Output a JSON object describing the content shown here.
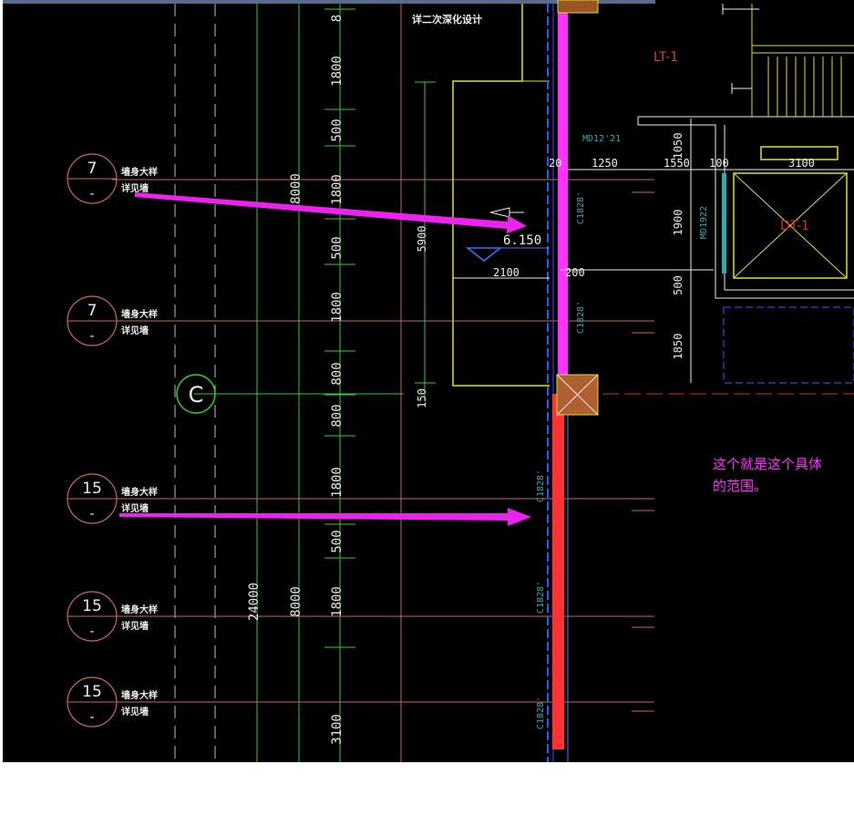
{
  "drawing": {
    "top_note": "详二次深化设计",
    "stair_label": "LT-1",
    "door_top": "MD12'21",
    "door_right": "MD1922",
    "equipment_label": "DT-1",
    "level_mark": "6.150",
    "axis_bubble": "C",
    "wall_codes": [
      "C1828'",
      "C1828'",
      "C1828'",
      "C1828'",
      "C1828'"
    ],
    "callouts": [
      {
        "number": "7",
        "line1": "墙身大样",
        "line2": "详见墙"
      },
      {
        "number": "7",
        "line1": "墙身大样",
        "line2": "详见墙"
      },
      {
        "number": "15",
        "line1": "墙身大样",
        "line2": "详见墙"
      },
      {
        "number": "15",
        "line1": "墙身大样",
        "line2": "详见墙"
      },
      {
        "number": "15",
        "line1": "墙身大样",
        "line2": "详见墙"
      }
    ],
    "vertical_dims": {
      "col_a": [
        "8",
        "1800",
        "500",
        "1800",
        "500",
        "1800",
        "800",
        "800",
        "1800",
        "500",
        "1800",
        "3100"
      ],
      "overall_8000_top": "8000",
      "overall_8000_bottom": "8000",
      "overall_24000": "24000",
      "inner_5900": "5900",
      "inner_150": "150",
      "right_1050": "1050",
      "right_1900": "1900",
      "right_500": "500",
      "right_1850": "1850"
    },
    "horizontal_dims": {
      "d20": "20",
      "d1250": "1250",
      "d1550": "1550",
      "d100": "100",
      "d3100": "3100",
      "d2100": "2100",
      "d200": "200"
    },
    "annotation": "这个就是这个具体的范围。",
    "annotation_line1": "这个就是这个具体",
    "annotation_line2": "的范围。"
  },
  "colors": {
    "background": "#000000",
    "annotation": "#ff33ff",
    "arrow": "#ee22ee",
    "wall_red": "#ff3333",
    "green_axis": "#33cc33",
    "dim_line": "#cc6666",
    "cyan_text": "#33aaaa",
    "yellow": "#ffff55"
  }
}
